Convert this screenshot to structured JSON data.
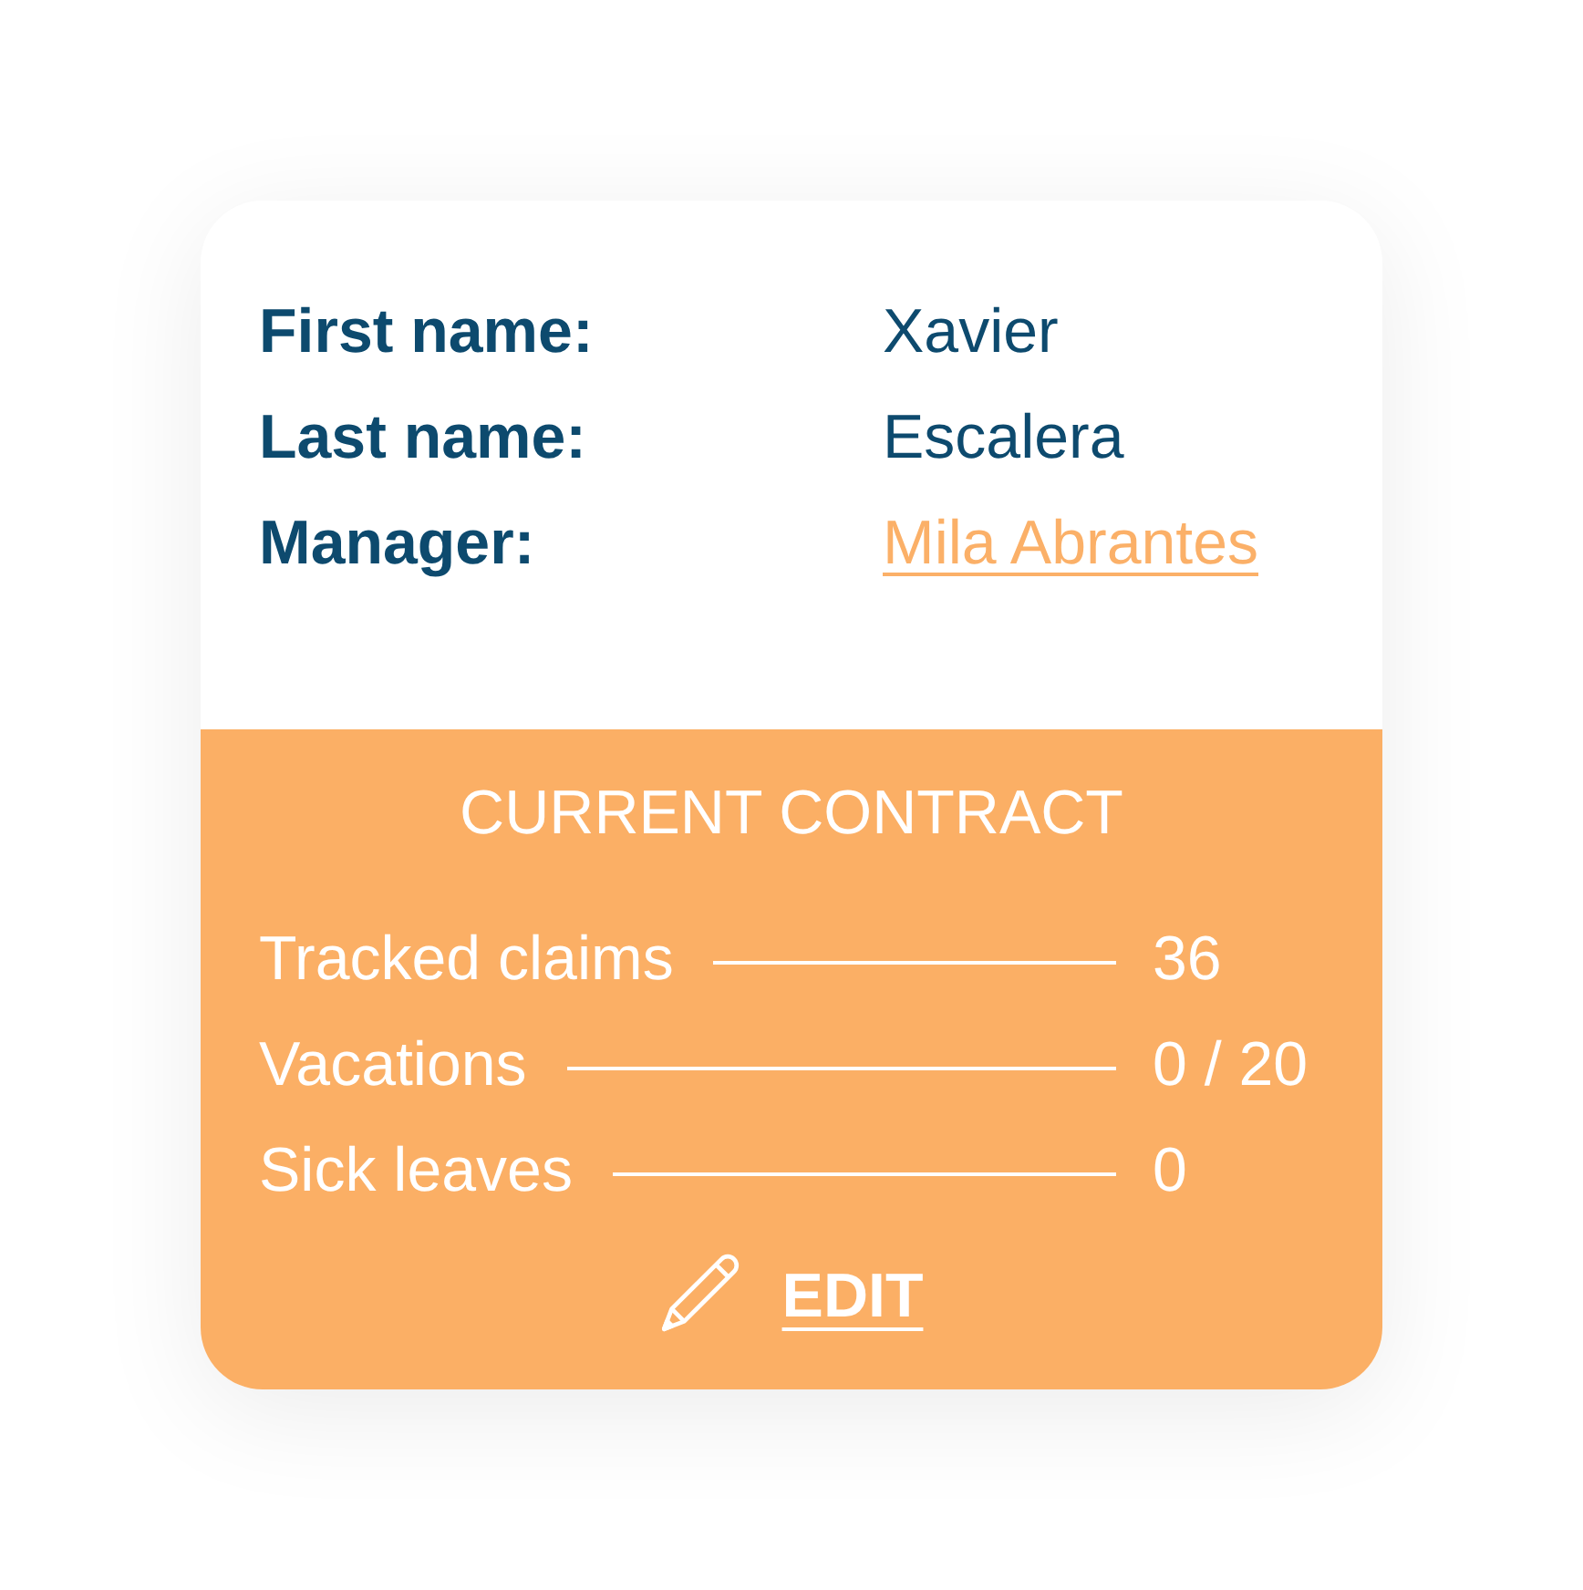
{
  "person": {
    "fields": [
      {
        "label": "First name:",
        "value": "Xavier",
        "kind": "text"
      },
      {
        "label": "Last name:",
        "value": "Escalera",
        "kind": "text"
      },
      {
        "label": "Manager:",
        "value": "Mila Abrantes",
        "kind": "link"
      }
    ]
  },
  "contract": {
    "title": "CURRENT CONTRACT",
    "stats": [
      {
        "label": "Tracked claims",
        "value": "36"
      },
      {
        "label": "Vacations",
        "value": "0 / 20"
      },
      {
        "label": "Sick leaves",
        "value": "0"
      }
    ],
    "edit_action": "EDIT"
  }
}
